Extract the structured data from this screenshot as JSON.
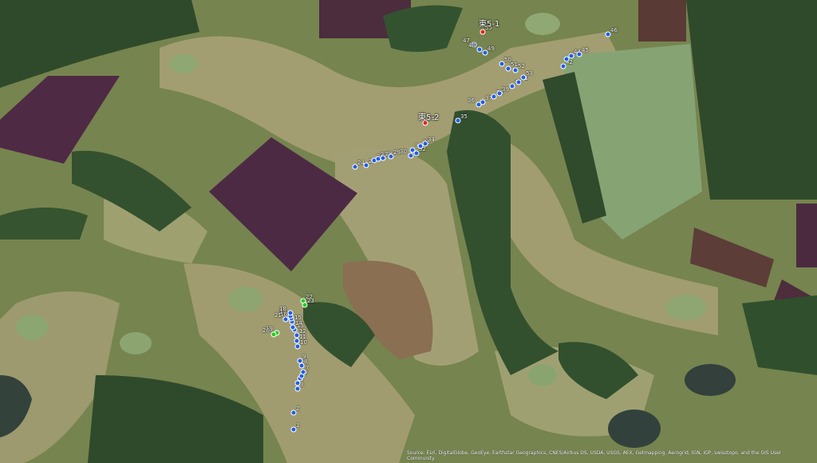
{
  "stations": [
    {
      "id": "east-5-1",
      "label": "東5-1"
    },
    {
      "id": "east-5-2",
      "label": "東5-2"
    }
  ],
  "points": [
    {
      "label": "1",
      "type": "blue"
    },
    {
      "label": "2",
      "type": "blue"
    },
    {
      "label": "3",
      "type": "blue"
    },
    {
      "label": "4",
      "type": "blue"
    },
    {
      "label": "5",
      "type": "blue"
    },
    {
      "label": "6",
      "type": "blue"
    },
    {
      "label": "7",
      "type": "blue"
    },
    {
      "label": "8",
      "type": "blue"
    },
    {
      "label": "9",
      "type": "blue"
    },
    {
      "label": "10",
      "type": "blue"
    },
    {
      "label": "11",
      "type": "blue"
    },
    {
      "label": "12",
      "type": "blue"
    },
    {
      "label": "13",
      "type": "blue"
    },
    {
      "label": "14",
      "type": "blue"
    },
    {
      "label": "15",
      "type": "blue"
    },
    {
      "label": "16",
      "type": "blue"
    },
    {
      "label": "17",
      "type": "blue"
    },
    {
      "label": "18",
      "type": "blue"
    },
    {
      "label": "19",
      "type": "green"
    },
    {
      "label": "20",
      "type": "green"
    },
    {
      "label": "21",
      "type": "blue"
    },
    {
      "label": "22",
      "type": "green"
    },
    {
      "label": "23",
      "type": "green"
    },
    {
      "label": "24",
      "type": "blue"
    },
    {
      "label": "25",
      "type": "blue"
    },
    {
      "label": "26",
      "type": "blue"
    },
    {
      "label": "27",
      "type": "blue"
    },
    {
      "label": "28",
      "type": "blue"
    },
    {
      "label": "29",
      "type": "blue"
    },
    {
      "label": "30",
      "type": "blue"
    },
    {
      "label": "31",
      "type": "blue"
    },
    {
      "label": "32",
      "type": "blue"
    },
    {
      "label": "33",
      "type": "blue"
    },
    {
      "label": "34",
      "type": "blue"
    },
    {
      "label": "35",
      "type": "blue"
    },
    {
      "label": "36",
      "type": "blue"
    },
    {
      "label": "37",
      "type": "blue"
    },
    {
      "label": "38",
      "type": "blue"
    },
    {
      "label": "39",
      "type": "blue"
    },
    {
      "label": "40",
      "type": "blue"
    },
    {
      "label": "41",
      "type": "blue"
    },
    {
      "label": "42",
      "type": "blue"
    },
    {
      "label": "43",
      "type": "blue"
    },
    {
      "label": "44",
      "type": "blue"
    },
    {
      "label": "45",
      "type": "blue"
    },
    {
      "label": "46",
      "type": "blue"
    },
    {
      "label": "47",
      "type": "blue"
    },
    {
      "label": "48",
      "type": "blue"
    },
    {
      "label": "49",
      "type": "blue"
    },
    {
      "label": "50",
      "type": "blue"
    },
    {
      "label": "51",
      "type": "blue"
    },
    {
      "label": "52",
      "type": "blue"
    },
    {
      "label": "53",
      "type": "blue"
    },
    {
      "label": "54",
      "type": "red"
    },
    {
      "label": "55",
      "type": "red"
    }
  ],
  "colors": {
    "blue": "#1f5ee8",
    "green": "#22cc22",
    "red": "#e52222"
  },
  "attribution": "Source: Esri, DigitalGlobe, GeoEye, Earthstar Geographics, CNES/Airbus DS, USDA, USGS, AEX, Getmapping, Aerogrid, IGN, IGP, swisstopo, and the GIS User Community"
}
